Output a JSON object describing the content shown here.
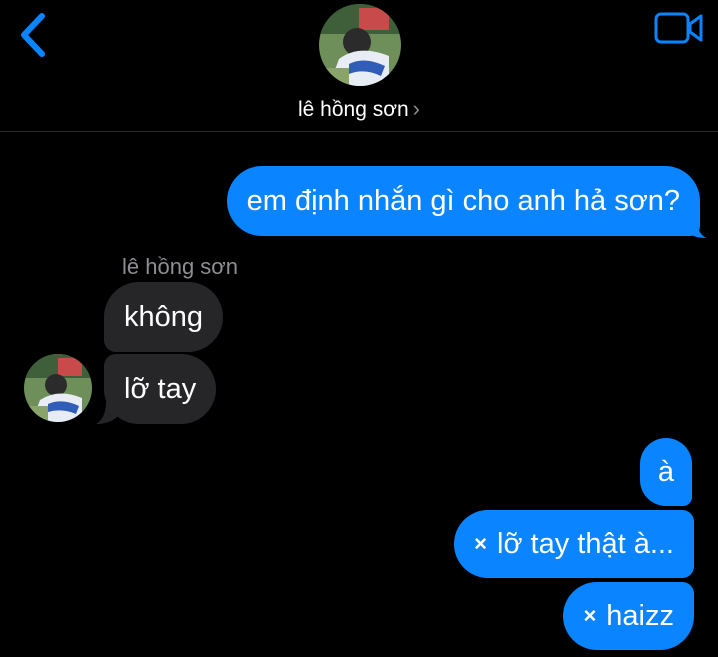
{
  "header": {
    "contact_name": "lê hồng sơn",
    "chevron": "›",
    "back_icon": "chevron-left-icon",
    "video_icon": "video-camera-icon",
    "avatar_icon": "profile-photo"
  },
  "conversation": {
    "sender_label": "lê hồng sơn",
    "messages": [
      {
        "from": "me",
        "text": "em định nhắn gì cho anh hả sơn?"
      },
      {
        "from": "them",
        "text": "không"
      },
      {
        "from": "them",
        "text": "lỡ tay"
      },
      {
        "from": "me",
        "text": "à"
      },
      {
        "from": "me",
        "mark": "×",
        "text": "lỡ tay thật à..."
      },
      {
        "from": "me",
        "mark": "×",
        "text": "haizz"
      }
    ]
  },
  "colors": {
    "accent": "#0a84ff",
    "received_bubble": "#262628",
    "background": "#000000",
    "secondary_text": "#8e8e93"
  }
}
